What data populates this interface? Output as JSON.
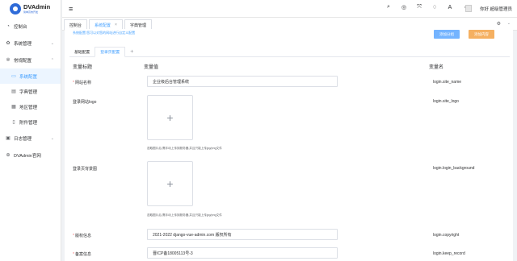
{
  "app": {
    "name": "DVAdmin",
    "subtitle": "简单高效开发"
  },
  "sidebar": {
    "items": [
      {
        "label": "控制台",
        "icon": "dashboard-icon"
      },
      {
        "label": "系统管理",
        "icon": "gear-icon",
        "arrow": "⌄"
      },
      {
        "label": "常规配置",
        "icon": "config-icon",
        "arrow": "⌃"
      },
      {
        "label": "系统配置",
        "icon": "monitor-icon"
      },
      {
        "label": "字典管理",
        "icon": "book-icon"
      },
      {
        "label": "地区管理",
        "icon": "map-icon"
      },
      {
        "label": "附件管理",
        "icon": "file-icon"
      },
      {
        "label": "日志管理",
        "icon": "log-icon",
        "arrow": "⌄"
      },
      {
        "label": "DVAdmin官网",
        "icon": "globe-icon"
      }
    ]
  },
  "topbar": {
    "user_label": "你好 超级管理员"
  },
  "tabs": [
    {
      "label": "控制台"
    },
    {
      "label": "系统配置",
      "close": "×"
    },
    {
      "label": "字典管理"
    }
  ],
  "tabs_more": "⚙",
  "tabs_arrow": "⌄",
  "main": {
    "notice": "系统配置:您可以对您的网站进行自定义配置",
    "save_label": "添加分组",
    "reset_label": "添加内容",
    "inner_tabs": [
      "基础配置",
      "登录页配置",
      "+"
    ],
    "headers": {
      "title": "变量标题",
      "value": "变量值",
      "name": "变量名"
    },
    "rows": {
      "site_name": {
        "label": "网站名称",
        "value": "企业级后台管理系统",
        "name": "login.site_name"
      },
      "site_logo": {
        "label": "登录网站logo",
        "name": "login.site_logo",
        "tip": "选取图片后,需手动上传到服务器,并且只能上传jpg/png文件"
      },
      "background": {
        "label": "登录页背景图",
        "name": "login.login_background",
        "tip": "选取图片后,需手动上传到服务器,并且只能上传jpg/png文件"
      },
      "copyright": {
        "label": "版权信息",
        "value": "2021-2022 django-vue-admin.com 版权所有",
        "name": "login.copyright"
      },
      "keep_record": {
        "label": "备案信息",
        "value": "晋ICP备18005113号-3",
        "name": "login.keep_record"
      }
    }
  },
  "colors": {
    "primary": "#409eff",
    "warning": "#f5b061",
    "danger": "#f56c6c"
  }
}
